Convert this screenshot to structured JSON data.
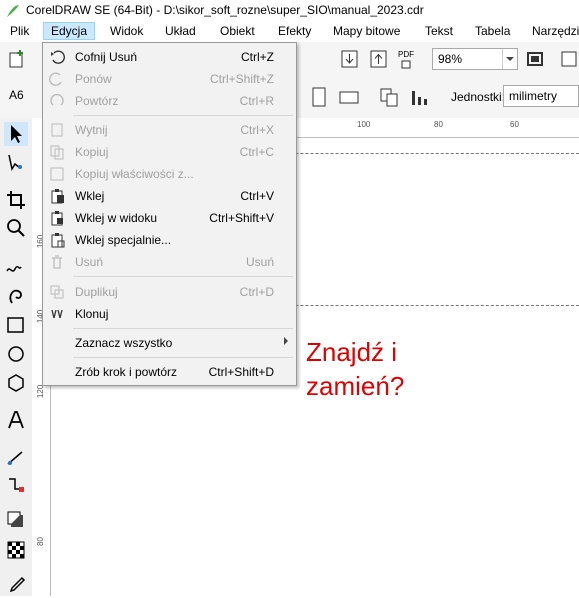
{
  "window": {
    "title": "CorelDRAW SE (64-Bit) - D:\\sikor_soft_rozne\\super_SIO\\manual_2023.cdr"
  },
  "menubar": {
    "items": [
      "Plik",
      "Edycja",
      "Widok",
      "Układ",
      "Obiekt",
      "Efekty",
      "Mapy bitowe",
      "Tekst",
      "Tabela",
      "Narzędzia"
    ]
  },
  "toolbar": {
    "zoom": "98%",
    "pdf_label": "PDF",
    "page_size": "A6",
    "units_label": "Jednostki:",
    "units_value": "milimetry"
  },
  "ruler": {
    "h_ticks": [
      "100",
      "80",
      "60"
    ],
    "v_ticks": [
      "160",
      "140",
      "120",
      "80"
    ]
  },
  "canvas": {
    "line1": "Znajdź i",
    "line2": "zamień?"
  },
  "edit_menu": {
    "undo": {
      "label": "Cofnij Usuń",
      "shortcut": "Ctrl+Z"
    },
    "redo": {
      "label": "Ponów",
      "shortcut": "Ctrl+Shift+Z"
    },
    "repeat": {
      "label": "Powtórz",
      "shortcut": "Ctrl+R"
    },
    "cut": {
      "label": "Wytnij",
      "shortcut": "Ctrl+X"
    },
    "copy": {
      "label": "Kopiuj",
      "shortcut": "Ctrl+C"
    },
    "copy_props": {
      "label": "Kopiuj właściwości z...",
      "shortcut": ""
    },
    "paste": {
      "label": "Wklej",
      "shortcut": "Ctrl+V"
    },
    "paste_inplace": {
      "label": "Wklej w widoku",
      "shortcut": "Ctrl+Shift+V"
    },
    "paste_special": {
      "label": "Wklej specjalnie...",
      "shortcut": ""
    },
    "delete": {
      "label": "Usuń",
      "shortcut": "Usuń"
    },
    "duplicate": {
      "label": "Duplikuj",
      "shortcut": "Ctrl+D"
    },
    "clone": {
      "label": "Klonuj",
      "shortcut": ""
    },
    "select_all": {
      "label": "Zaznacz wszystko"
    },
    "step_repeat": {
      "label": "Zrób krok i powtórz",
      "shortcut": "Ctrl+Shift+D"
    }
  }
}
